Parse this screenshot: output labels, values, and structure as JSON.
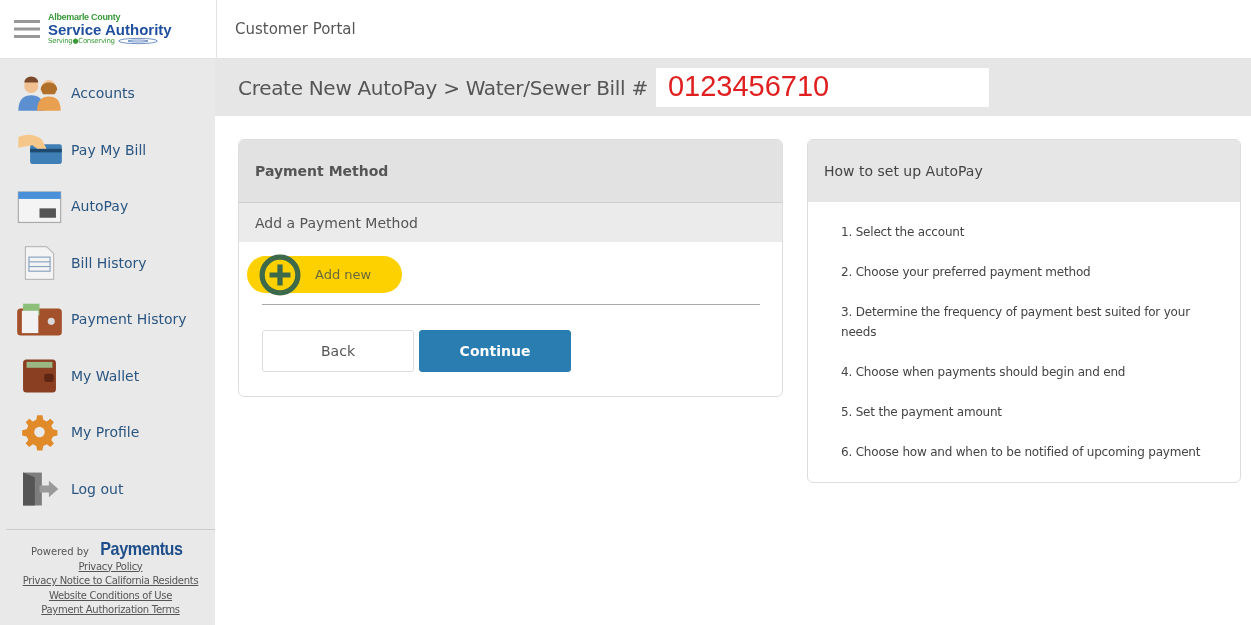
{
  "header": {
    "logo": {
      "line_1": "Albemarle County",
      "line_2": "Service Authority",
      "line_3": "Serving●Conserving"
    },
    "title": "Customer Portal"
  },
  "sidebar": {
    "items": [
      {
        "label": "Accounts"
      },
      {
        "label": "Pay My Bill"
      },
      {
        "label": "AutoPay"
      },
      {
        "label": "Bill History"
      },
      {
        "label": "Payment History"
      },
      {
        "label": "My Wallet"
      },
      {
        "label": "My Profile"
      },
      {
        "label": "Log out"
      }
    ],
    "footer": {
      "powered_by": "Powered by",
      "brand": "Paymentus",
      "links": [
        "Privacy Policy",
        "Privacy Notice to California Residents",
        "Website Conditions of Use",
        "Payment Authorization Terms"
      ]
    }
  },
  "page_title": {
    "text": "Create New AutoPay > Water/Sewer Bill #",
    "account_number": "0123456710"
  },
  "payment_card": {
    "title": "Payment Method",
    "subtitle": "Add a Payment Method",
    "add_button": "Add new",
    "buttons": [
      "Back",
      "Continue"
    ]
  },
  "help_card": {
    "title": "How to set up AutoPay",
    "steps": [
      "1. Select the account",
      "2. Choose your preferred payment method",
      "3. Determine the frequency of payment best suited for your needs",
      "4. Choose when payments should begin and end",
      "5. Set the payment amount",
      "6. Choose how and when to be notified of upcoming payment"
    ]
  }
}
